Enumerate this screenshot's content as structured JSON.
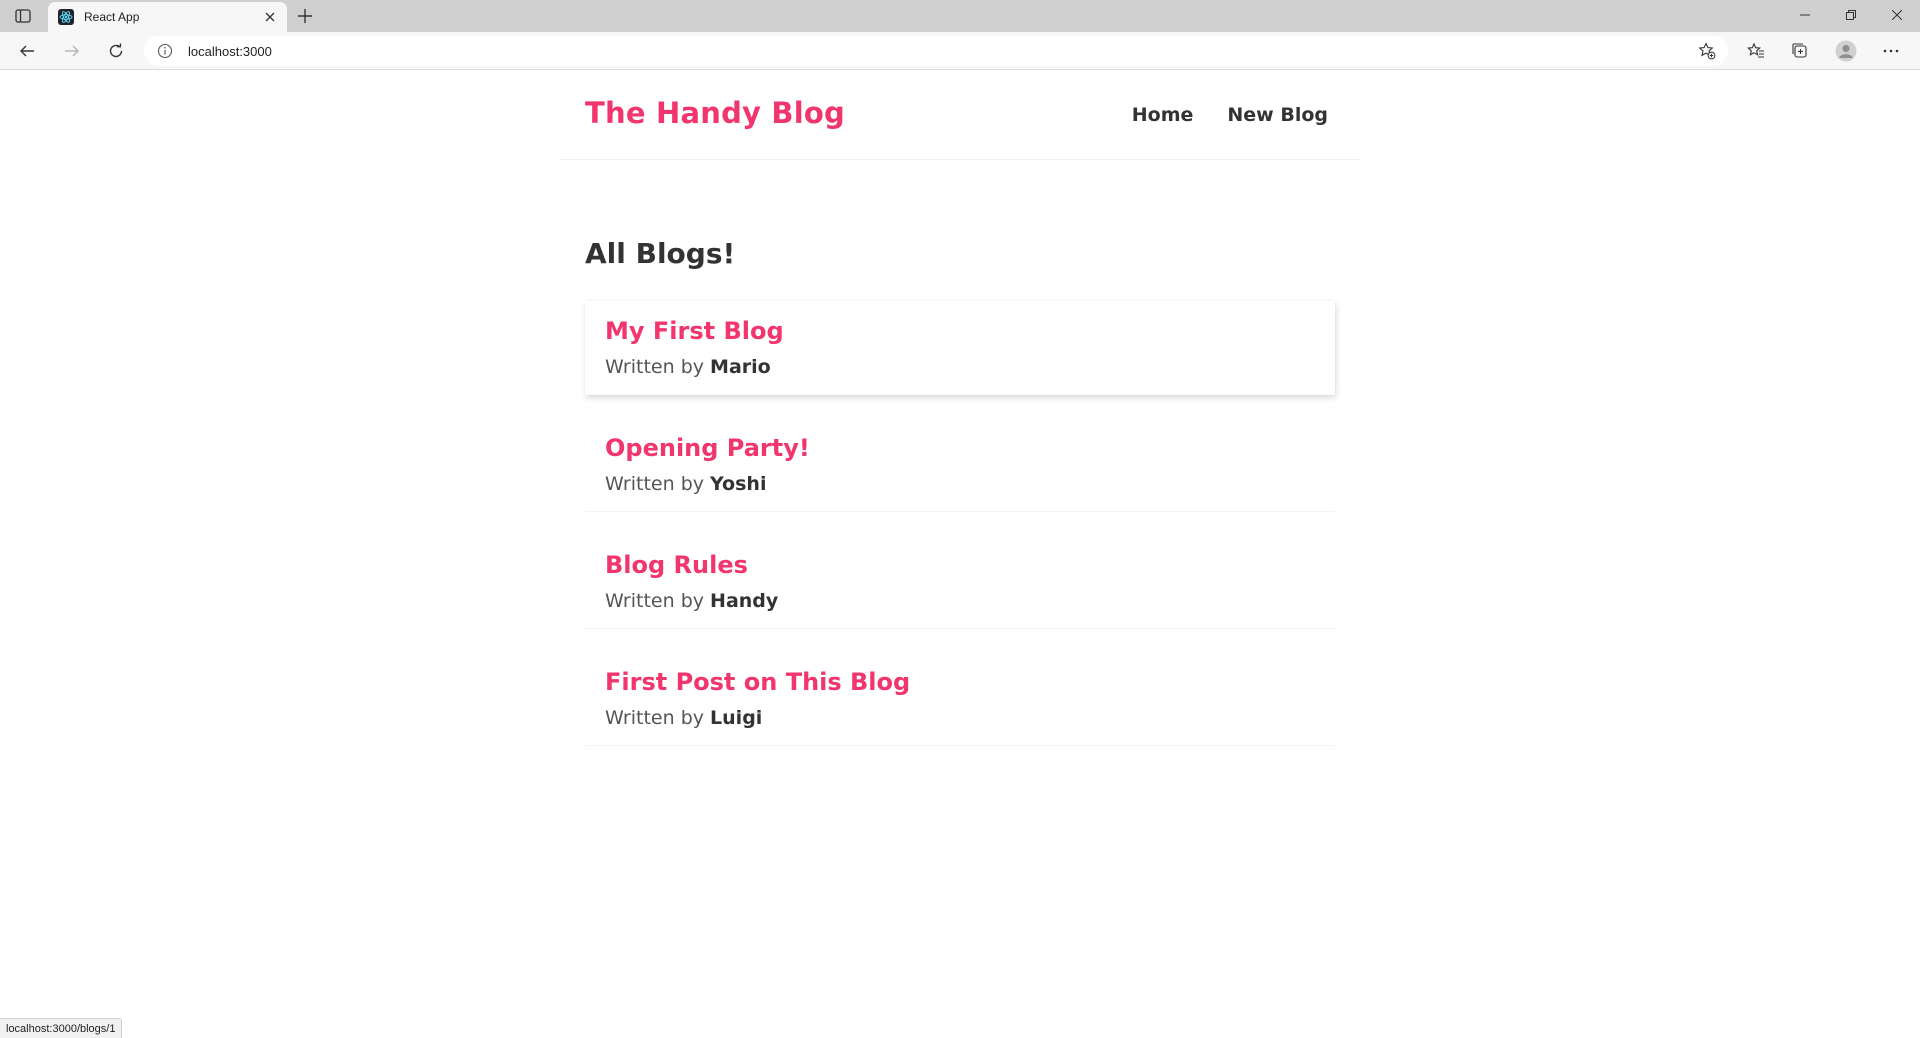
{
  "browser": {
    "tab_title": "React App",
    "address": "localhost:3000",
    "status_url": "localhost:3000/blogs/1"
  },
  "icons": {
    "tab_actions": "tab-actions-icon",
    "favicon": "react-icon",
    "close": "close-icon",
    "new_tab": "plus-icon",
    "back": "arrow-left-icon",
    "forward": "arrow-right-icon",
    "refresh": "refresh-icon",
    "site_info": "info-icon",
    "add_favorite": "star-plus-icon",
    "favorites": "favorites-icon",
    "collections": "collections-icon",
    "profile": "avatar-icon",
    "more": "more-icon"
  },
  "colors": {
    "brand": "#f1356d",
    "text": "#333333"
  },
  "navbar": {
    "brand": "The Handy Blog",
    "links": [
      "Home",
      "New Blog"
    ]
  },
  "home": {
    "title": "All Blogs!",
    "author_prefix": "Written by",
    "blogs": [
      {
        "title": "My First Blog",
        "author": "Mario"
      },
      {
        "title": "Opening Party!",
        "author": "Yoshi"
      },
      {
        "title": "Blog Rules",
        "author": "Handy"
      },
      {
        "title": "First Post on This Blog",
        "author": "Luigi"
      }
    ]
  }
}
